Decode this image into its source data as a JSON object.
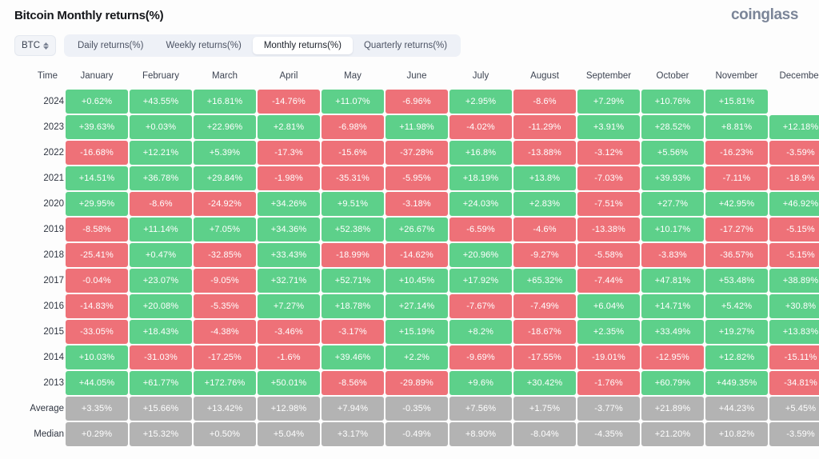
{
  "header": {
    "title": "Bitcoin Monthly returns(%)",
    "brand": "coinglass"
  },
  "toolbar": {
    "symbol": "BTC",
    "symbol_icon": "chevron-up-down-icon",
    "tabs": [
      {
        "label": "Daily returns(%)",
        "active": false
      },
      {
        "label": "Weekly returns(%)",
        "active": false
      },
      {
        "label": "Monthly returns(%)",
        "active": true
      },
      {
        "label": "Quarterly returns(%)",
        "active": false
      }
    ]
  },
  "colors": {
    "positive": "#5dd08a",
    "negative": "#ee7178",
    "stat": "#b3b3b3",
    "brand": "#7b8598",
    "tab_bar": "#eef1f7"
  },
  "chart_data": {
    "type": "heatmap",
    "title": "Bitcoin Monthly returns(%)",
    "xlabel": "",
    "ylabel": "Time",
    "categories": [
      "January",
      "February",
      "March",
      "April",
      "May",
      "June",
      "July",
      "August",
      "September",
      "October",
      "November",
      "December"
    ],
    "row_header": "Time",
    "rows": [
      {
        "label": "2024",
        "kind": "year",
        "values": [
          "+0.62%",
          "+43.55%",
          "+16.81%",
          "-14.76%",
          "+11.07%",
          "-6.96%",
          "+2.95%",
          "-8.6%",
          "+7.29%",
          "+10.76%",
          "+15.81%",
          ""
        ]
      },
      {
        "label": "2023",
        "kind": "year",
        "values": [
          "+39.63%",
          "+0.03%",
          "+22.96%",
          "+2.81%",
          "-6.98%",
          "+11.98%",
          "-4.02%",
          "-11.29%",
          "+3.91%",
          "+28.52%",
          "+8.81%",
          "+12.18%"
        ]
      },
      {
        "label": "2022",
        "kind": "year",
        "values": [
          "-16.68%",
          "+12.21%",
          "+5.39%",
          "-17.3%",
          "-15.6%",
          "-37.28%",
          "+16.8%",
          "-13.88%",
          "-3.12%",
          "+5.56%",
          "-16.23%",
          "-3.59%"
        ]
      },
      {
        "label": "2021",
        "kind": "year",
        "values": [
          "+14.51%",
          "+36.78%",
          "+29.84%",
          "-1.98%",
          "-35.31%",
          "-5.95%",
          "+18.19%",
          "+13.8%",
          "-7.03%",
          "+39.93%",
          "-7.11%",
          "-18.9%"
        ]
      },
      {
        "label": "2020",
        "kind": "year",
        "values": [
          "+29.95%",
          "-8.6%",
          "-24.92%",
          "+34.26%",
          "+9.51%",
          "-3.18%",
          "+24.03%",
          "+2.83%",
          "-7.51%",
          "+27.7%",
          "+42.95%",
          "+46.92%"
        ]
      },
      {
        "label": "2019",
        "kind": "year",
        "values": [
          "-8.58%",
          "+11.14%",
          "+7.05%",
          "+34.36%",
          "+52.38%",
          "+26.67%",
          "-6.59%",
          "-4.6%",
          "-13.38%",
          "+10.17%",
          "-17.27%",
          "-5.15%"
        ]
      },
      {
        "label": "2018",
        "kind": "year",
        "values": [
          "-25.41%",
          "+0.47%",
          "-32.85%",
          "+33.43%",
          "-18.99%",
          "-14.62%",
          "+20.96%",
          "-9.27%",
          "-5.58%",
          "-3.83%",
          "-36.57%",
          "-5.15%"
        ]
      },
      {
        "label": "2017",
        "kind": "year",
        "values": [
          "-0.04%",
          "+23.07%",
          "-9.05%",
          "+32.71%",
          "+52.71%",
          "+10.45%",
          "+17.92%",
          "+65.32%",
          "-7.44%",
          "+47.81%",
          "+53.48%",
          "+38.89%"
        ]
      },
      {
        "label": "2016",
        "kind": "year",
        "values": [
          "-14.83%",
          "+20.08%",
          "-5.35%",
          "+7.27%",
          "+18.78%",
          "+27.14%",
          "-7.67%",
          "-7.49%",
          "+6.04%",
          "+14.71%",
          "+5.42%",
          "+30.8%"
        ]
      },
      {
        "label": "2015",
        "kind": "year",
        "values": [
          "-33.05%",
          "+18.43%",
          "-4.38%",
          "-3.46%",
          "-3.17%",
          "+15.19%",
          "+8.2%",
          "-18.67%",
          "+2.35%",
          "+33.49%",
          "+19.27%",
          "+13.83%"
        ]
      },
      {
        "label": "2014",
        "kind": "year",
        "values": [
          "+10.03%",
          "-31.03%",
          "-17.25%",
          "-1.6%",
          "+39.46%",
          "+2.2%",
          "-9.69%",
          "-17.55%",
          "-19.01%",
          "-12.95%",
          "+12.82%",
          "-15.11%"
        ]
      },
      {
        "label": "2013",
        "kind": "year",
        "values": [
          "+44.05%",
          "+61.77%",
          "+172.76%",
          "+50.01%",
          "-8.56%",
          "-29.89%",
          "+9.6%",
          "+30.42%",
          "-1.76%",
          "+60.79%",
          "+449.35%",
          "-34.81%"
        ]
      },
      {
        "label": "Average",
        "kind": "stat",
        "values": [
          "+3.35%",
          "+15.66%",
          "+13.42%",
          "+12.98%",
          "+7.94%",
          "-0.35%",
          "+7.56%",
          "+1.75%",
          "-3.77%",
          "+21.89%",
          "+44.23%",
          "+5.45%"
        ]
      },
      {
        "label": "Median",
        "kind": "stat",
        "values": [
          "+0.29%",
          "+15.32%",
          "+0.50%",
          "+5.04%",
          "+3.17%",
          "-0.49%",
          "+8.90%",
          "-8.04%",
          "-4.35%",
          "+21.20%",
          "+10.82%",
          "-3.59%"
        ]
      }
    ]
  }
}
